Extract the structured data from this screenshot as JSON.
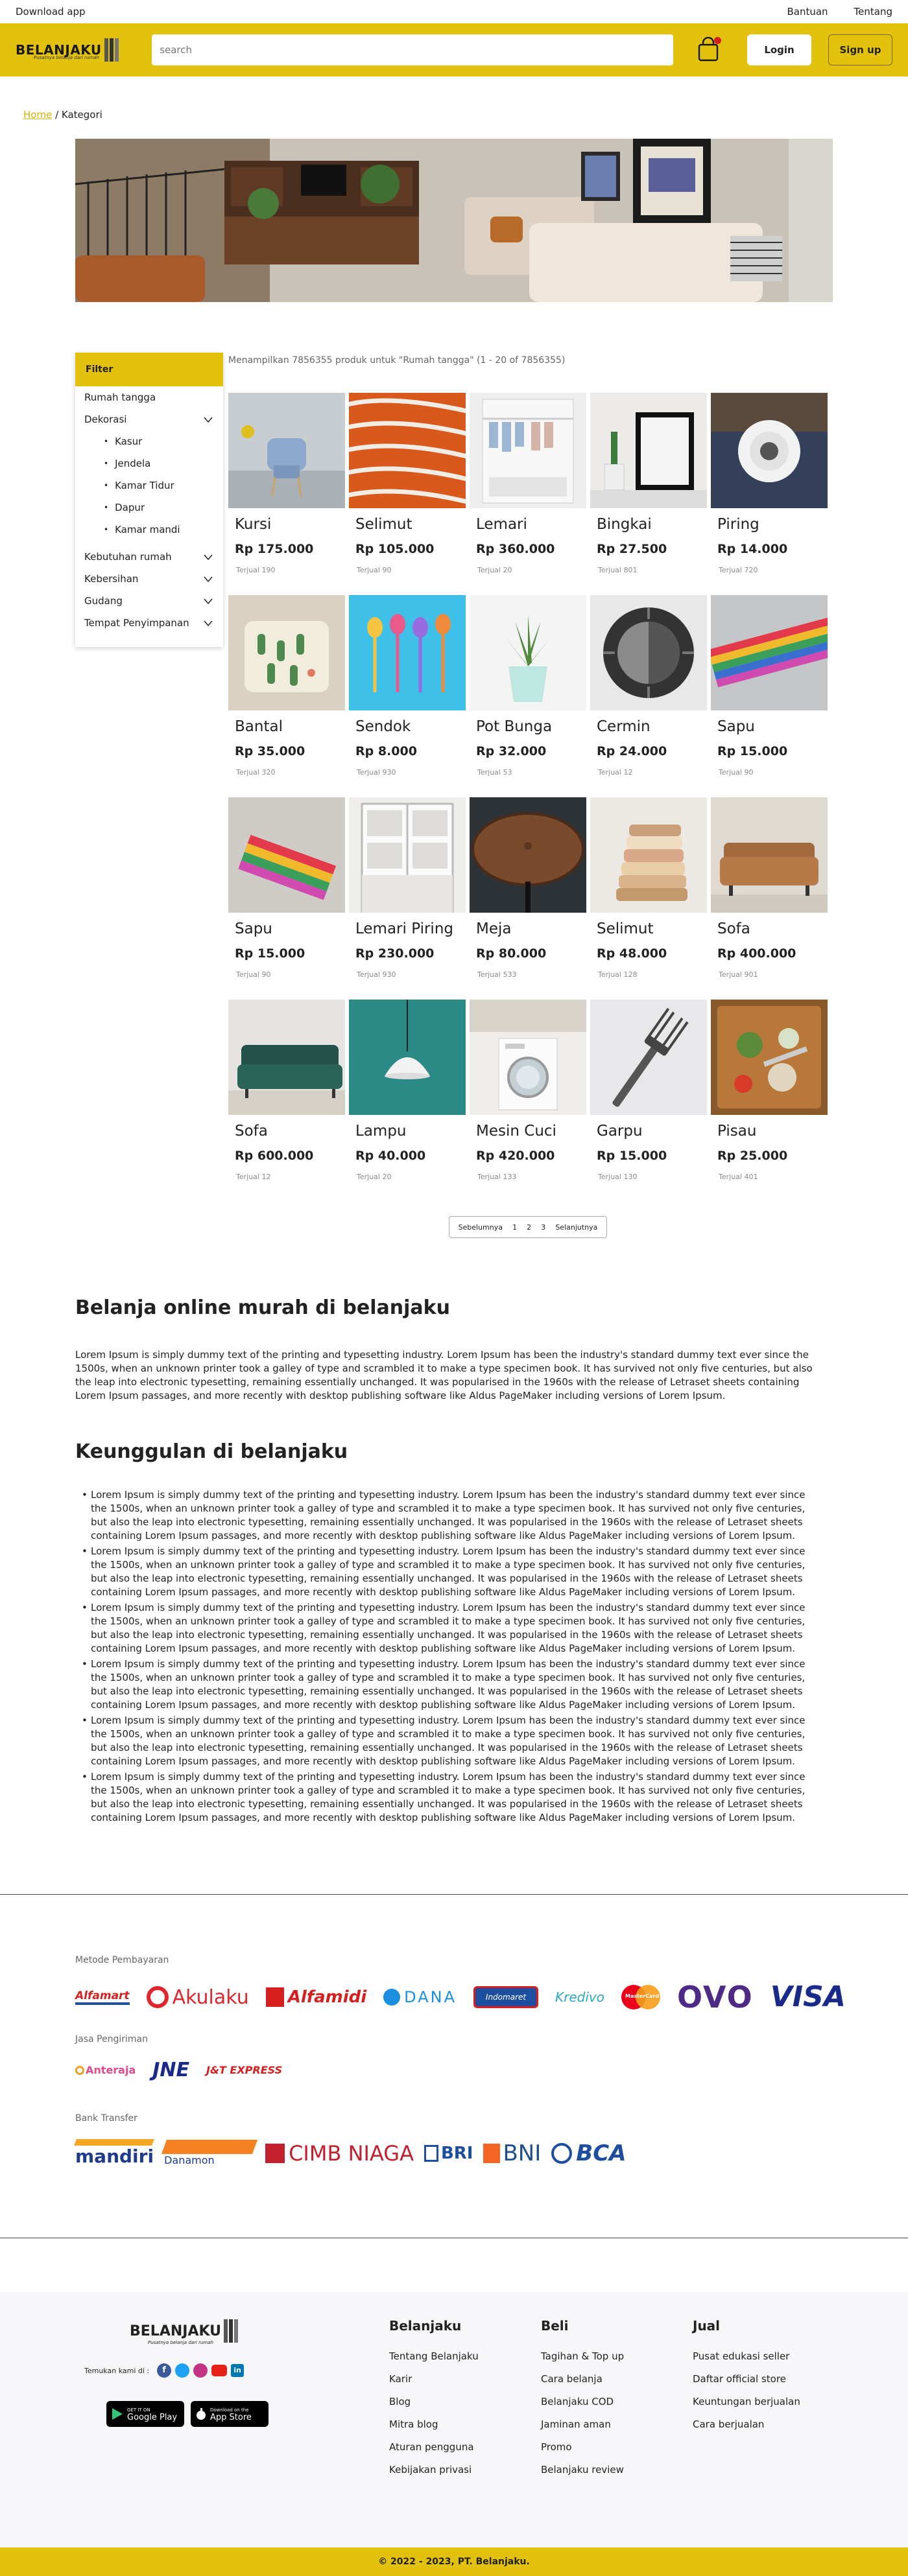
{
  "topbar": {
    "download": "Download app",
    "help": "Bantuan",
    "about": "Tentang"
  },
  "header": {
    "logo_text": "BELANJAKU",
    "logo_tagline": "Pusatnya belanja dari rumah",
    "search_placeholder": "search",
    "login": "Login",
    "signup": "Sign up"
  },
  "breadcrumb": {
    "home": "Home",
    "sep": " / ",
    "current": "Kategori"
  },
  "filter": {
    "title": "Filter",
    "items": [
      "Rumah tangga",
      "Dekorasi",
      "Kasur",
      "Jendela",
      "Kamar Tidur",
      "Dapur",
      "Kamar mandi",
      "Kebutuhan rumah",
      "Kebersihan",
      "Gudang",
      "Tempat Penyimpanan"
    ]
  },
  "results_info": "Menampilkan 7856355 produk untuk \"Rumah tangga\" (1 - 20 of 7856355)",
  "products": [
    {
      "name": "Kursi",
      "price": "Rp 175.000",
      "sold": "Terjual 190"
    },
    {
      "name": "Selimut",
      "price": "Rp 105.000",
      "sold": "Terjual 90"
    },
    {
      "name": "Lemari",
      "price": "Rp 360.000",
      "sold": "Terjual 20"
    },
    {
      "name": "Bingkai",
      "price": "Rp 27.500",
      "sold": "Terjual 801"
    },
    {
      "name": "Piring",
      "price": "Rp 14.000",
      "sold": "Terjual 720"
    },
    {
      "name": "Bantal",
      "price": "Rp 35.000",
      "sold": "Terjual 320"
    },
    {
      "name": "Sendok",
      "price": "Rp 8.000",
      "sold": "Terjual 930"
    },
    {
      "name": "Pot Bunga",
      "price": "Rp 32.000",
      "sold": "Terjual 53"
    },
    {
      "name": "Cermin",
      "price": "Rp 24.000",
      "sold": "Terjual 12"
    },
    {
      "name": "Sapu",
      "price": "Rp 15.000",
      "sold": "Terjual 90"
    },
    {
      "name": "Sapu",
      "price": "Rp 15.000",
      "sold": "Terjual 90"
    },
    {
      "name": "Lemari Piring",
      "price": "Rp 230.000",
      "sold": "Terjual 930"
    },
    {
      "name": "Meja",
      "price": "Rp 80.000",
      "sold": "Terjual 533"
    },
    {
      "name": "Selimut",
      "price": "Rp 48.000",
      "sold": "Terjual 128"
    },
    {
      "name": "Sofa",
      "price": "Rp 400.000",
      "sold": "Terjual 901"
    },
    {
      "name": "Sofa",
      "price": "Rp 600.000",
      "sold": "Terjual 12"
    },
    {
      "name": "Lampu",
      "price": "Rp 40.000",
      "sold": "Terjual 20"
    },
    {
      "name": "Mesin Cuci",
      "price": "Rp 420.000",
      "sold": "Terjual 133"
    },
    {
      "name": "Garpu",
      "price": "Rp 15.000",
      "sold": "Terjual 130"
    },
    {
      "name": "Pisau",
      "price": "Rp 25.000",
      "sold": "Terjual 401"
    }
  ],
  "pager": {
    "prev": "Sebelumnya",
    "pages": [
      "1",
      "2",
      "3"
    ],
    "next": "Selanjutnya"
  },
  "about": {
    "title": "Belanja online murah di belanjaku",
    "text": "Lorem Ipsum is simply dummy text of the printing and typesetting industry. Lorem Ipsum has been the industry's standard dummy text ever since the 1500s, when an unknown printer took a galley of type and scrambled it to make a type specimen book. It has survived not only five centuries, but also the leap into electronic typesetting, remaining essentially unchanged. It was popularised in the 1960s with the release of Letraset sheets containing Lorem Ipsum passages, and more recently with desktop publishing software like Aldus PageMaker including versions of Lorem Ipsum."
  },
  "advantages": {
    "title": "Keunggulan di belanjaku",
    "items": [
      "Lorem Ipsum is simply dummy text of the printing and typesetting industry. Lorem Ipsum has been the industry's standard dummy text ever since the 1500s, when an unknown printer took a galley of type and scrambled it to make a type specimen book. It has survived not only five centuries, but also the leap into electronic typesetting, remaining essentially unchanged. It was popularised in the 1960s with the release of Letraset sheets containing Lorem Ipsum passages, and more recently with desktop publishing software like Aldus PageMaker including versions of Lorem Ipsum.",
      "Lorem Ipsum is simply dummy text of the printing and typesetting industry. Lorem Ipsum has been the industry's standard dummy text ever since the 1500s, when an unknown printer took a galley of type and scrambled it to make a type specimen book. It has survived not only five centuries, but also the leap into electronic typesetting, remaining essentially unchanged. It was popularised in the 1960s with the release of Letraset sheets containing Lorem Ipsum passages, and more recently with desktop publishing software like Aldus PageMaker including versions of Lorem Ipsum.",
      "Lorem Ipsum is simply dummy text of the printing and typesetting industry. Lorem Ipsum has been the industry's standard dummy text ever since the 1500s, when an unknown printer took a galley of type and scrambled it to make a type specimen book. It has survived not only five centuries, but also the leap into electronic typesetting, remaining essentially unchanged. It was popularised in the 1960s with the release of Letraset sheets containing Lorem Ipsum passages, and more recently with desktop publishing software like Aldus PageMaker including versions of Lorem Ipsum.",
      "Lorem Ipsum is simply dummy text of the printing and typesetting industry. Lorem Ipsum has been the industry's standard dummy text ever since the 1500s, when an unknown printer took a galley of type and scrambled it to make a type specimen book. It has survived not only five centuries, but also the leap into electronic typesetting, remaining essentially unchanged. It was popularised in the 1960s with the release of Letraset sheets containing Lorem Ipsum passages, and more recently with desktop publishing software like Aldus PageMaker including versions of Lorem Ipsum.",
      "Lorem Ipsum is simply dummy text of the printing and typesetting industry. Lorem Ipsum has been the industry's standard dummy text ever since the 1500s, when an unknown printer took a galley of type and scrambled it to make a type specimen book. It has survived not only five centuries, but also the leap into electronic typesetting, remaining essentially unchanged. It was popularised in the 1960s with the release of Letraset sheets containing Lorem Ipsum passages, and more recently with desktop publishing software like Aldus PageMaker including versions of Lorem Ipsum.",
      "Lorem Ipsum is simply dummy text of the printing and typesetting industry. Lorem Ipsum has been the industry's standard dummy text ever since the 1500s, when an unknown printer took a galley of type and scrambled it to make a type specimen book. It has survived not only five centuries, but also the leap into electronic typesetting, remaining essentially unchanged. It was popularised in the 1960s with the release of Letraset sheets containing Lorem Ipsum passages, and more recently with desktop publishing software like Aldus PageMaker including versions of Lorem Ipsum."
    ]
  },
  "payments": {
    "label": "Metode Pembayaran",
    "logos": [
      "Alfamart",
      "Akulaku",
      "Alfamidi",
      "DANA",
      "Indomaret",
      "Kredivo",
      "MasterCard",
      "OVO",
      "VISA"
    ]
  },
  "shipping": {
    "label": "Jasa Pengiriman",
    "logos": [
      "Anteraja",
      "JNE",
      "J&T EXPRESS"
    ]
  },
  "banks": {
    "label": "Bank Transfer",
    "logos": [
      "mandiri",
      "Danamon",
      "CIMB NIAGA",
      "BRI",
      "BNI",
      "BCA"
    ]
  },
  "footer": {
    "follow": "Temukan kami di :",
    "google_play": "Google Play",
    "get_it_on": "GET IT ON",
    "app_store": "App Store",
    "download_on": "Download on the",
    "col1": {
      "title": "Belanjaku",
      "links": [
        "Tentang Belanjaku",
        "Karir",
        "Blog",
        "Mitra blog",
        "Aturan pengguna",
        "Kebijakan privasi"
      ]
    },
    "col2": {
      "title": "Beli",
      "links": [
        "Tagihan & Top up",
        "Cara belanja",
        "Belanjaku COD",
        "Jaminan aman",
        "Promo",
        "Belanjaku review"
      ]
    },
    "col3": {
      "title": "Jual",
      "links": [
        "Pusat edukasi seller",
        "Daftar official store",
        "Keuntungan berjualan",
        "Cara berjualan"
      ]
    },
    "copyright": "© 2022 - 2023, PT. Belanjaku."
  },
  "colors": {
    "brand": "#e3c20e",
    "badge": "#d62020"
  }
}
